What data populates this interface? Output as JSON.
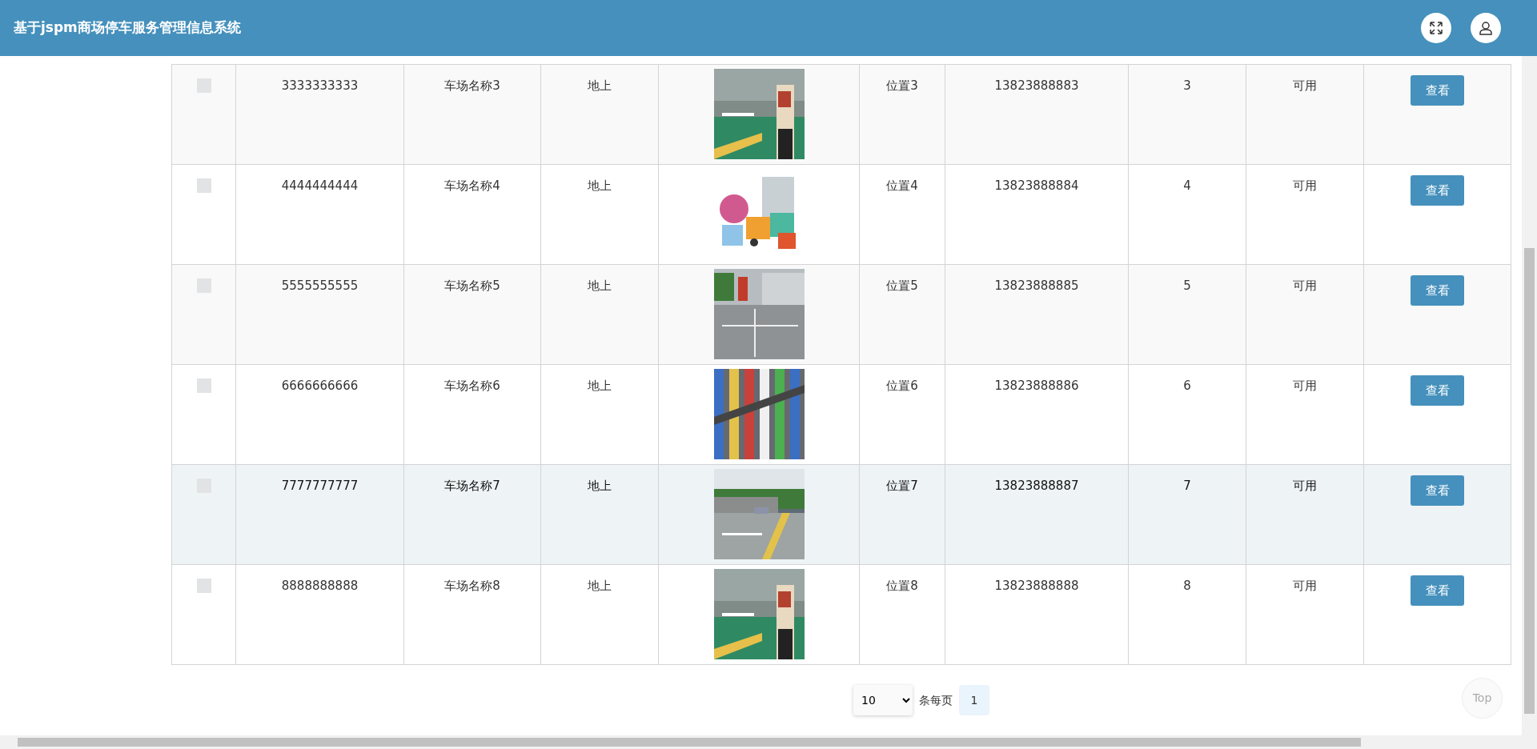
{
  "header": {
    "title": "基于jspm商场停车服务管理信息系统"
  },
  "table": {
    "rows": [
      {
        "checked": false,
        "highlighted": false,
        "number": "3333333333",
        "name": "车场名称3",
        "type": "地上",
        "location": "位置3",
        "phone": "13823888883",
        "count": "3",
        "status": "可用",
        "action": "查看"
      },
      {
        "checked": false,
        "highlighted": false,
        "number": "4444444444",
        "name": "车场名称4",
        "type": "地上",
        "location": "位置4",
        "phone": "13823888884",
        "count": "4",
        "status": "可用",
        "action": "查看"
      },
      {
        "checked": false,
        "highlighted": false,
        "number": "5555555555",
        "name": "车场名称5",
        "type": "地上",
        "location": "位置5",
        "phone": "13823888885",
        "count": "5",
        "status": "可用",
        "action": "查看"
      },
      {
        "checked": false,
        "highlighted": false,
        "number": "6666666666",
        "name": "车场名称6",
        "type": "地上",
        "location": "位置6",
        "phone": "13823888886",
        "count": "6",
        "status": "可用",
        "action": "查看"
      },
      {
        "checked": false,
        "highlighted": true,
        "number": "7777777777",
        "name": "车场名称7",
        "type": "地上",
        "location": "位置7",
        "phone": "13823888887",
        "count": "7",
        "status": "可用",
        "action": "查看"
      },
      {
        "checked": false,
        "highlighted": false,
        "number": "8888888888",
        "name": "车场名称8",
        "type": "地上",
        "location": "位置8",
        "phone": "13823888888",
        "count": "8",
        "status": "可用",
        "action": "查看"
      }
    ]
  },
  "pagination": {
    "page_size": "10",
    "per_page_label": "条每页",
    "pages": [
      {
        "label": "1",
        "selected": true
      }
    ]
  },
  "top_button": "Top"
}
